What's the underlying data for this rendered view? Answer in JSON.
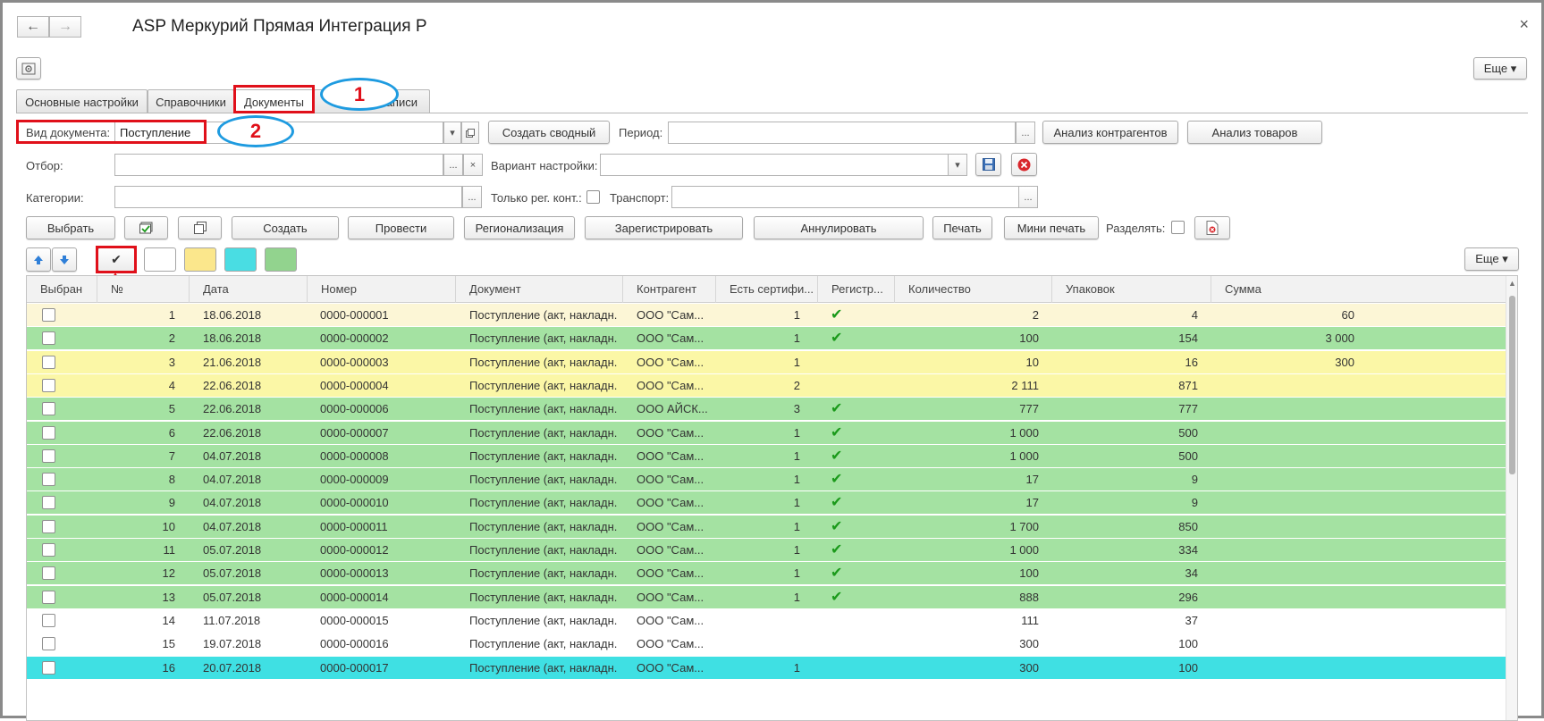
{
  "window": {
    "title": "ASP Меркурий Прямая Интеграция Р",
    "back_icon": "←",
    "forward_icon": "→",
    "close_icon": "×"
  },
  "toolbar_top": {
    "more_label": "Еще ▾"
  },
  "tabs": [
    {
      "label": "Основные настройки"
    },
    {
      "label": "Справочники"
    },
    {
      "label": "Документы"
    },
    {
      "label": "Записи"
    }
  ],
  "callouts": [
    "1",
    "2"
  ],
  "filters": {
    "doc_type_label": "Вид документа:",
    "doc_type_value": "Поступление",
    "create_summary": "Создать сводный",
    "period_label": "Период:",
    "period_value": "",
    "analyze_contractors": "Анализ контрагентов",
    "analyze_goods": "Анализ товаров",
    "filter_label": "Отбор:",
    "variant_label": "Вариант настройки:",
    "categories_label": "Категории:",
    "only_reg_label": "Только рег. конт.:",
    "transport_label": "Транспорт:",
    "ellipsis": "...",
    "clear": "×",
    "dropdown": "▾"
  },
  "actions": {
    "select": "Выбрать",
    "create": "Создать",
    "post": "Провести",
    "regionalization": "Регионализация",
    "register": "Зарегистрировать",
    "annul": "Аннулировать",
    "print": "Печать",
    "mini_print": "Мини печать",
    "split_label": "Разделять:",
    "more": "Еще ▾",
    "check_mark": "✔"
  },
  "colors": {
    "row_yellow_light": "#fcf6d6",
    "row_green": "#a4e2a2",
    "row_yellow": "#fbf7a6",
    "row_white": "#ffffff",
    "row_cyan": "#3fe0e3",
    "swatch_white": "#ffffff",
    "swatch_yellow": "#fbe78c",
    "swatch_cyan": "#49dde3",
    "swatch_green": "#92d38e",
    "highlight_red": "#e0101a",
    "callout_blue": "#1e9be0"
  },
  "table": {
    "columns": [
      "Выбран",
      "№",
      "Дата",
      "Номер",
      "Документ",
      "Контрагент",
      "Есть сертифи...",
      "Регистр...",
      "Количество",
      "Упаковок",
      "Сумма"
    ],
    "rows": [
      {
        "n": "1",
        "date": "18.06.2018",
        "num": "0000-000001",
        "doc": "Поступление (акт, накладн...",
        "contr": "ООО \"Сам...",
        "cert": "1",
        "reg": "✔",
        "qty": "2",
        "pack": "4",
        "sum": "60",
        "color": "yellow_light"
      },
      {
        "n": "2",
        "date": "18.06.2018",
        "num": "0000-000002",
        "doc": "Поступление (акт, накладн...",
        "contr": "ООО \"Сам...",
        "cert": "1",
        "reg": "✔",
        "qty": "100",
        "pack": "154",
        "sum": "3 000",
        "color": "green"
      },
      {
        "n": "3",
        "date": "21.06.2018",
        "num": "0000-000003",
        "doc": "Поступление (акт, накладн...",
        "contr": "ООО \"Сам...",
        "cert": "1",
        "reg": "",
        "qty": "10",
        "pack": "16",
        "sum": "300",
        "color": "yellow"
      },
      {
        "n": "4",
        "date": "22.06.2018",
        "num": "0000-000004",
        "doc": "Поступление (акт, накладн...",
        "contr": "ООО \"Сам...",
        "cert": "2",
        "reg": "",
        "qty": "2 111",
        "pack": "871",
        "sum": "",
        "color": "yellow"
      },
      {
        "n": "5",
        "date": "22.06.2018",
        "num": "0000-000006",
        "doc": "Поступление (акт, накладн...",
        "contr": "ООО АЙСК...",
        "cert": "3",
        "reg": "✔",
        "qty": "777",
        "pack": "777",
        "sum": "",
        "color": "green"
      },
      {
        "n": "6",
        "date": "22.06.2018",
        "num": "0000-000007",
        "doc": "Поступление (акт, накладн...",
        "contr": "ООО \"Сам...",
        "cert": "1",
        "reg": "✔",
        "qty": "1 000",
        "pack": "500",
        "sum": "",
        "color": "green"
      },
      {
        "n": "7",
        "date": "04.07.2018",
        "num": "0000-000008",
        "doc": "Поступление (акт, накладн...",
        "contr": "ООО \"Сам...",
        "cert": "1",
        "reg": "✔",
        "qty": "1 000",
        "pack": "500",
        "sum": "",
        "color": "green"
      },
      {
        "n": "8",
        "date": "04.07.2018",
        "num": "0000-000009",
        "doc": "Поступление (акт, накладн...",
        "contr": "ООО \"Сам...",
        "cert": "1",
        "reg": "✔",
        "qty": "17",
        "pack": "9",
        "sum": "",
        "color": "green"
      },
      {
        "n": "9",
        "date": "04.07.2018",
        "num": "0000-000010",
        "doc": "Поступление (акт, накладн...",
        "contr": "ООО \"Сам...",
        "cert": "1",
        "reg": "✔",
        "qty": "17",
        "pack": "9",
        "sum": "",
        "color": "green"
      },
      {
        "n": "10",
        "date": "04.07.2018",
        "num": "0000-000011",
        "doc": "Поступление (акт, накладн...",
        "contr": "ООО \"Сам...",
        "cert": "1",
        "reg": "✔",
        "qty": "1 700",
        "pack": "850",
        "sum": "",
        "color": "green"
      },
      {
        "n": "11",
        "date": "05.07.2018",
        "num": "0000-000012",
        "doc": "Поступление (акт, накладн...",
        "contr": "ООО \"Сам...",
        "cert": "1",
        "reg": "✔",
        "qty": "1 000",
        "pack": "334",
        "sum": "",
        "color": "green"
      },
      {
        "n": "12",
        "date": "05.07.2018",
        "num": "0000-000013",
        "doc": "Поступление (акт, накладн...",
        "contr": "ООО \"Сам...",
        "cert": "1",
        "reg": "✔",
        "qty": "100",
        "pack": "34",
        "sum": "",
        "color": "green"
      },
      {
        "n": "13",
        "date": "05.07.2018",
        "num": "0000-000014",
        "doc": "Поступление (акт, накладн...",
        "contr": "ООО \"Сам...",
        "cert": "1",
        "reg": "✔",
        "qty": "888",
        "pack": "296",
        "sum": "",
        "color": "green"
      },
      {
        "n": "14",
        "date": "11.07.2018",
        "num": "0000-000015",
        "doc": "Поступление (акт, накладн...",
        "contr": "ООО \"Сам...",
        "cert": "",
        "reg": "",
        "qty": "111",
        "pack": "37",
        "sum": "",
        "color": "white"
      },
      {
        "n": "15",
        "date": "19.07.2018",
        "num": "0000-000016",
        "doc": "Поступление (акт, накладн...",
        "contr": "ООО \"Сам...",
        "cert": "",
        "reg": "",
        "qty": "300",
        "pack": "100",
        "sum": "",
        "color": "white"
      },
      {
        "n": "16",
        "date": "20.07.2018",
        "num": "0000-000017",
        "doc": "Поступление (акт, накладн...",
        "contr": "ООО \"Сам...",
        "cert": "1",
        "reg": "",
        "qty": "300",
        "pack": "100",
        "sum": "",
        "color": "cyan"
      }
    ]
  }
}
